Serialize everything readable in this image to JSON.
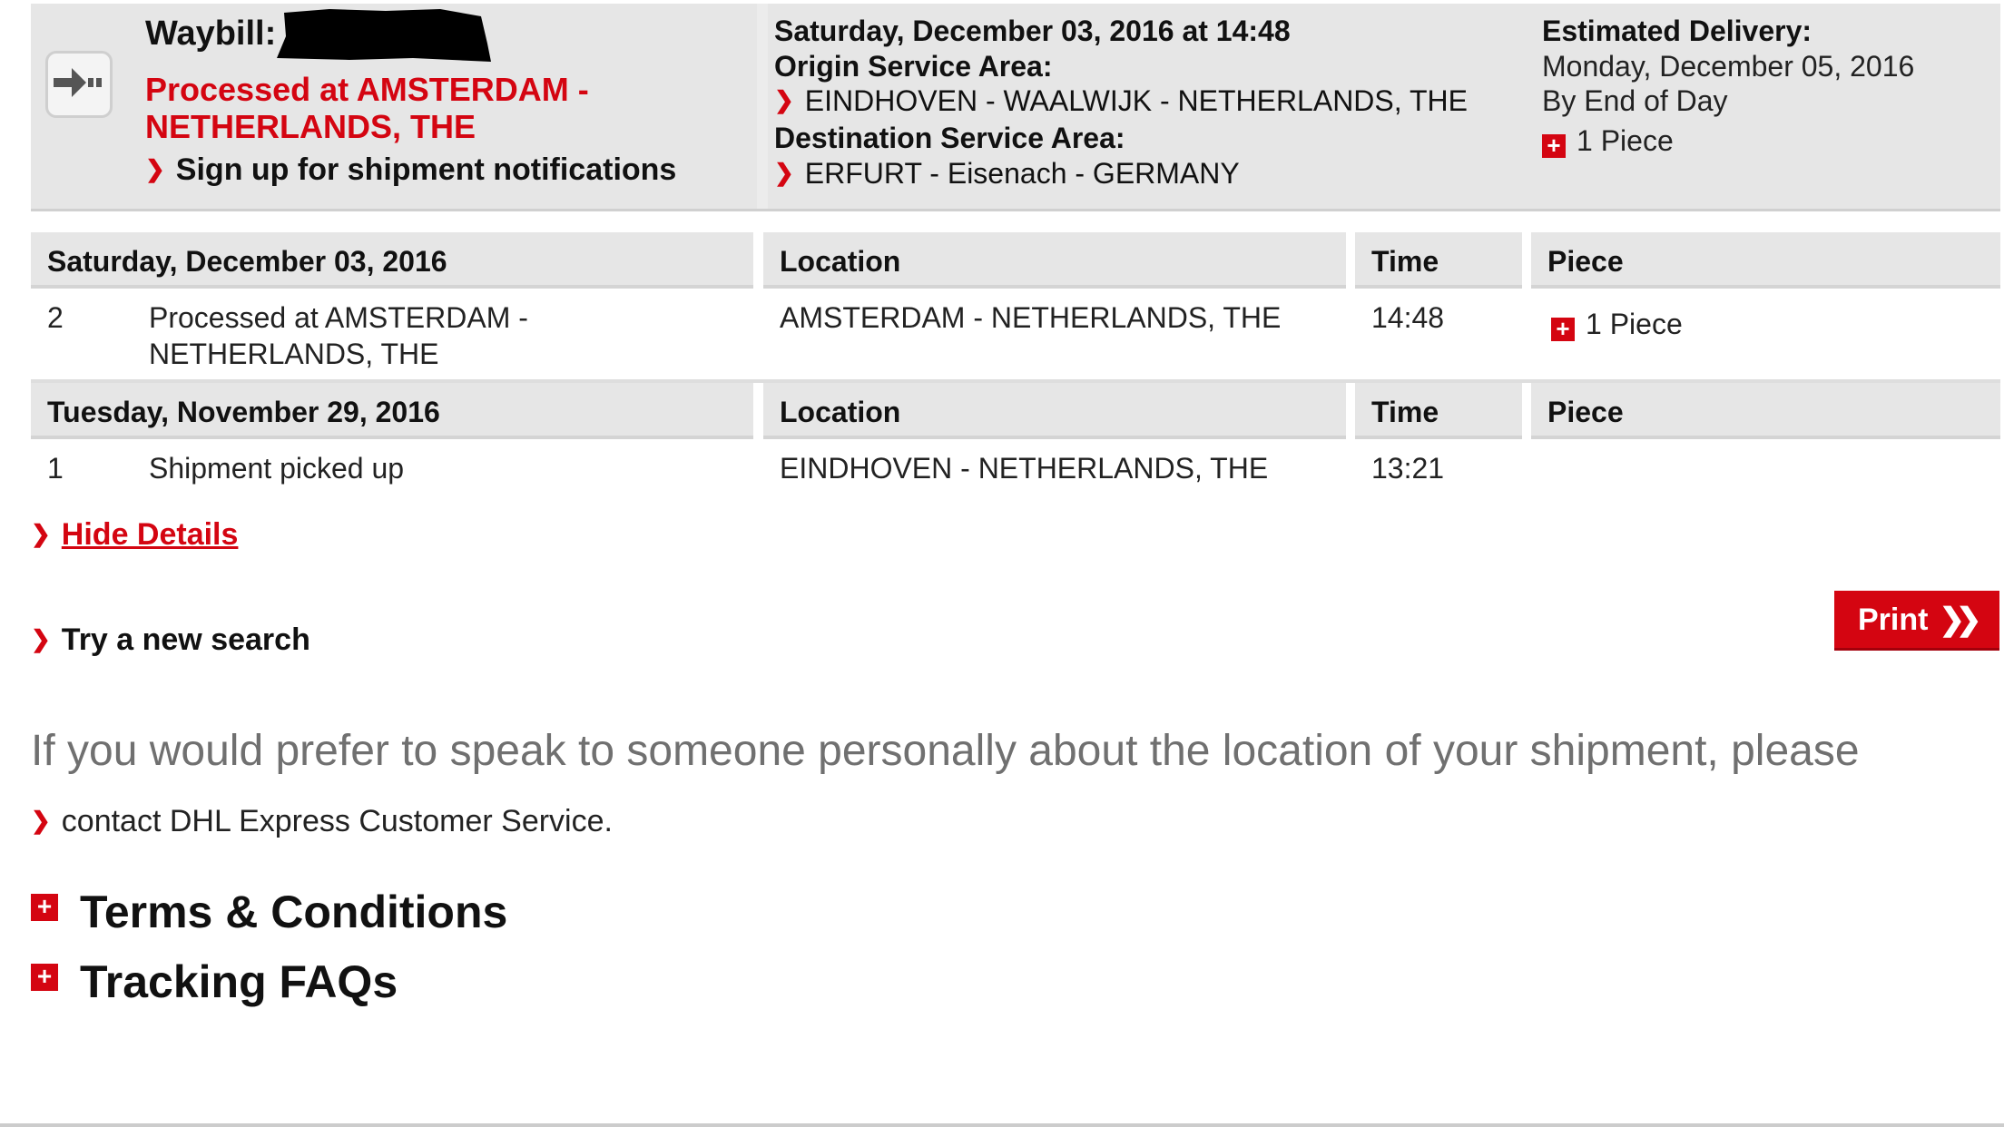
{
  "summary": {
    "waybill_label": "Waybill:",
    "status": "Processed at AMSTERDAM - NETHERLANDS, THE",
    "signup_link": "Sign up for shipment notifications",
    "date_time": "Saturday, December 03, 2016 at 14:48",
    "origin_label": "Origin Service Area:",
    "origin_value": "EINDHOVEN - WAALWIJK - NETHERLANDS, THE",
    "destination_label": "Destination Service Area:",
    "destination_value": "ERFURT - Eisenach - GERMANY",
    "estimated_label": "Estimated Delivery:",
    "estimated_date": "Monday, December 05, 2016",
    "estimated_time": "By End of Day",
    "pieces": "1 Piece"
  },
  "table": {
    "groups": [
      {
        "date": "Saturday, December 03, 2016",
        "location_header": "Location",
        "time_header": "Time",
        "piece_header": "Piece",
        "rows": [
          {
            "num": "2",
            "event": "Processed at AMSTERDAM - NETHERLANDS, THE",
            "location": "AMSTERDAM - NETHERLANDS, THE",
            "time": "14:48",
            "piece": "1 Piece"
          }
        ]
      },
      {
        "date": "Tuesday, November 29, 2016",
        "location_header": "Location",
        "time_header": "Time",
        "piece_header": "Piece",
        "rows": [
          {
            "num": "1",
            "event": "Shipment picked up",
            "location": "EINDHOVEN - NETHERLANDS, THE",
            "time": "13:21",
            "piece": ""
          }
        ]
      }
    ]
  },
  "links": {
    "hide_details": "Hide Details",
    "try_new_search": "Try a new search",
    "print": "Print"
  },
  "help": {
    "text": "If you would prefer to speak to someone personally about the location of your shipment, please",
    "contact": "contact  DHL Express Customer Service."
  },
  "sections": {
    "terms": "Terms & Conditions",
    "faqs": "Tracking FAQs"
  },
  "colors": {
    "accent": "#d40511",
    "header_bg": "#e6e6e6"
  }
}
